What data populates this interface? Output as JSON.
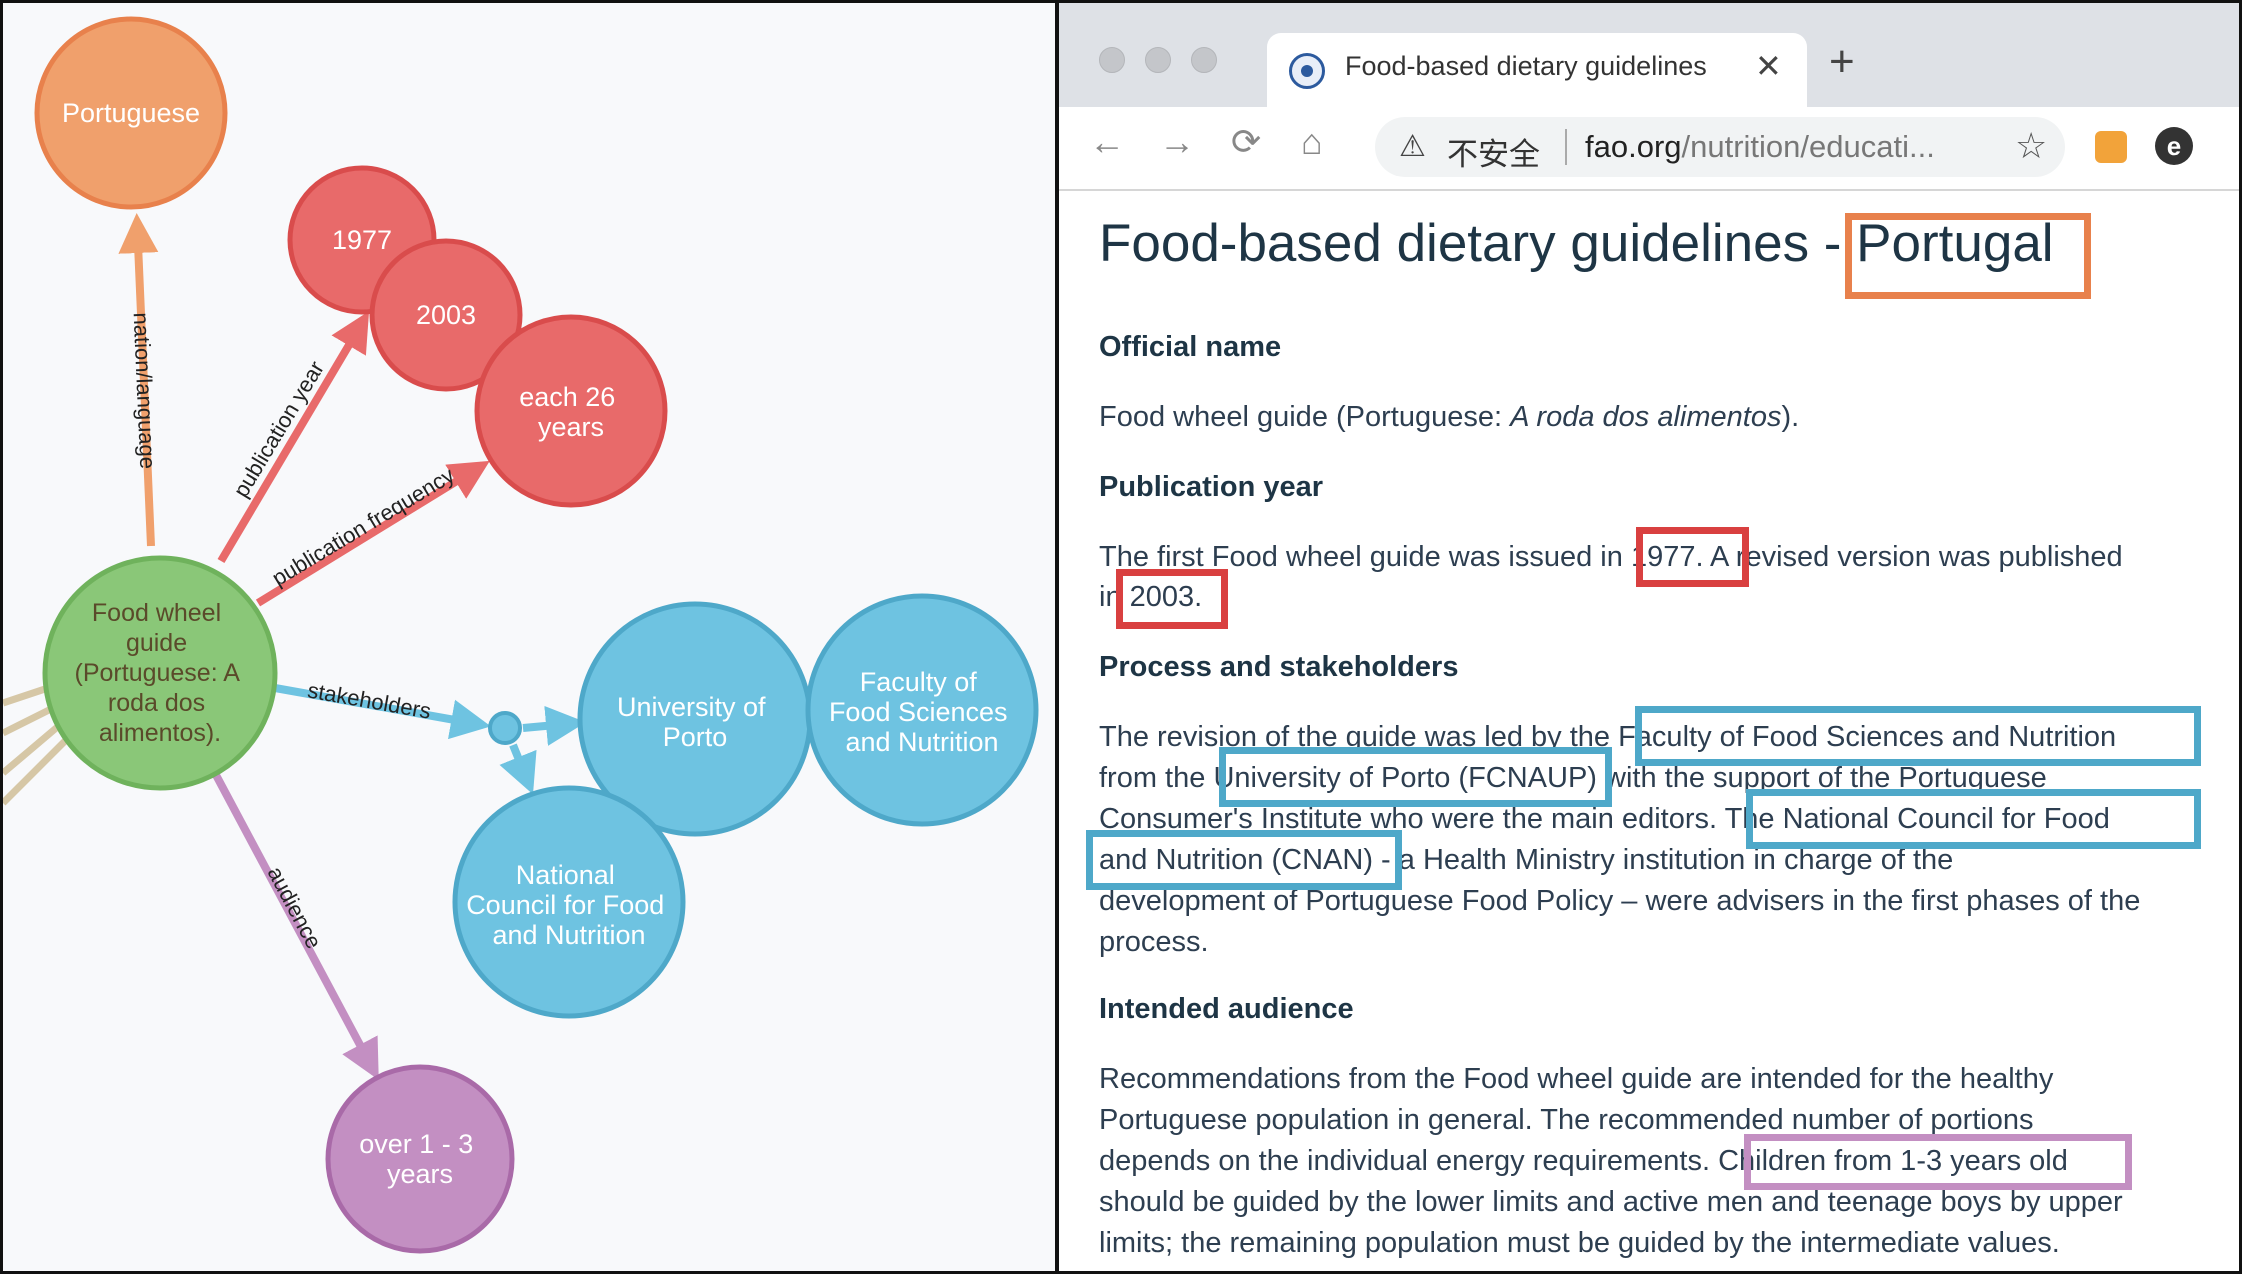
{
  "graph": {
    "nodes": {
      "portuguese": "Portuguese",
      "food_wheel": [
        "Food wheel",
        "guide",
        "(Portuguese: A",
        "roda dos",
        "alimentos)."
      ],
      "y1977": "1977",
      "y2003": "2003",
      "each26": [
        "each 26",
        "years"
      ],
      "uporto": [
        "University of",
        "Porto"
      ],
      "faculty": [
        "Faculty of",
        "Food Sciences",
        "and Nutrition"
      ],
      "cnan": [
        "National",
        "Council for Food",
        "and Nutrition"
      ],
      "audience": [
        "over 1 - 3",
        "years"
      ]
    },
    "edges": {
      "nation": "nation/language",
      "pubyear": "publication year",
      "pubfreq": "publication frequency",
      "stakeholders": "stakeholders",
      "audience": "audience"
    },
    "colors": {
      "orange": "#f0a06c",
      "red": "#e86a6a",
      "green": "#8ac778",
      "blue": "#6ec3e1",
      "purple": "#c38fc2",
      "tan": "#d6c7a6"
    }
  },
  "browser": {
    "tab_title": "Food-based dietary guidelines",
    "tab_close": "✕",
    "new_tab": "+",
    "back": "←",
    "forward": "→",
    "reload": "⟳",
    "home": "⌂",
    "warning": "⚠",
    "insecure": "不安全",
    "url_host": "fao.org",
    "url_path": "/nutrition/educati...",
    "star": "☆",
    "ext2": "e"
  },
  "article": {
    "title_prefix": "Food-based dietary guidelines - ",
    "title_country": "Portugal",
    "h_official": "Official name",
    "official_a": "Food wheel guide (Portuguese: ",
    "official_b": "A roda dos alimentos",
    "official_c": ").",
    "h_pubyear": "Publication year",
    "pub_l1a": "The first Food wheel guide was issued in ",
    "pub_l1b": "1977.",
    "pub_l1c": " A revised version was published",
    "pub_l2a": "in ",
    "pub_l2b": "2003.",
    "h_process": "Process and stakeholders",
    "proc_l1a": "The revision of the guide was led by the ",
    "proc_l1b": "Faculty of Food Sciences and Nutrition",
    "proc_l2a": "from the ",
    "proc_l2b": "University of Porto (FCNAUP)",
    "proc_l2c": " with the support of the Portuguese",
    "proc_l3a": "Consumer's Institute who were the main editors.",
    "proc_l3b": " The National Council for Food",
    "proc_l4a": "and Nutrition (CNAN)",
    "proc_l4b": " - a Health Ministry institution in charge of the",
    "proc_l5": "development of Portuguese Food Policy – were advisers in the first phases of the",
    "proc_l6": "process.",
    "h_audience": "Intended audience",
    "aud_l1": "Recommendations from the Food wheel guide are intended for the healthy",
    "aud_l2": "Portuguese population in general. The recommended number of portions",
    "aud_l3a": "depends on the individual energy requirements.",
    "aud_l3b": " Children from 1-3 years old",
    "aud_l4": "should be guided by the lower limits and active men and teenage boys by upper",
    "aud_l5": "limits; the remaining population must be guided by the intermediate values."
  }
}
